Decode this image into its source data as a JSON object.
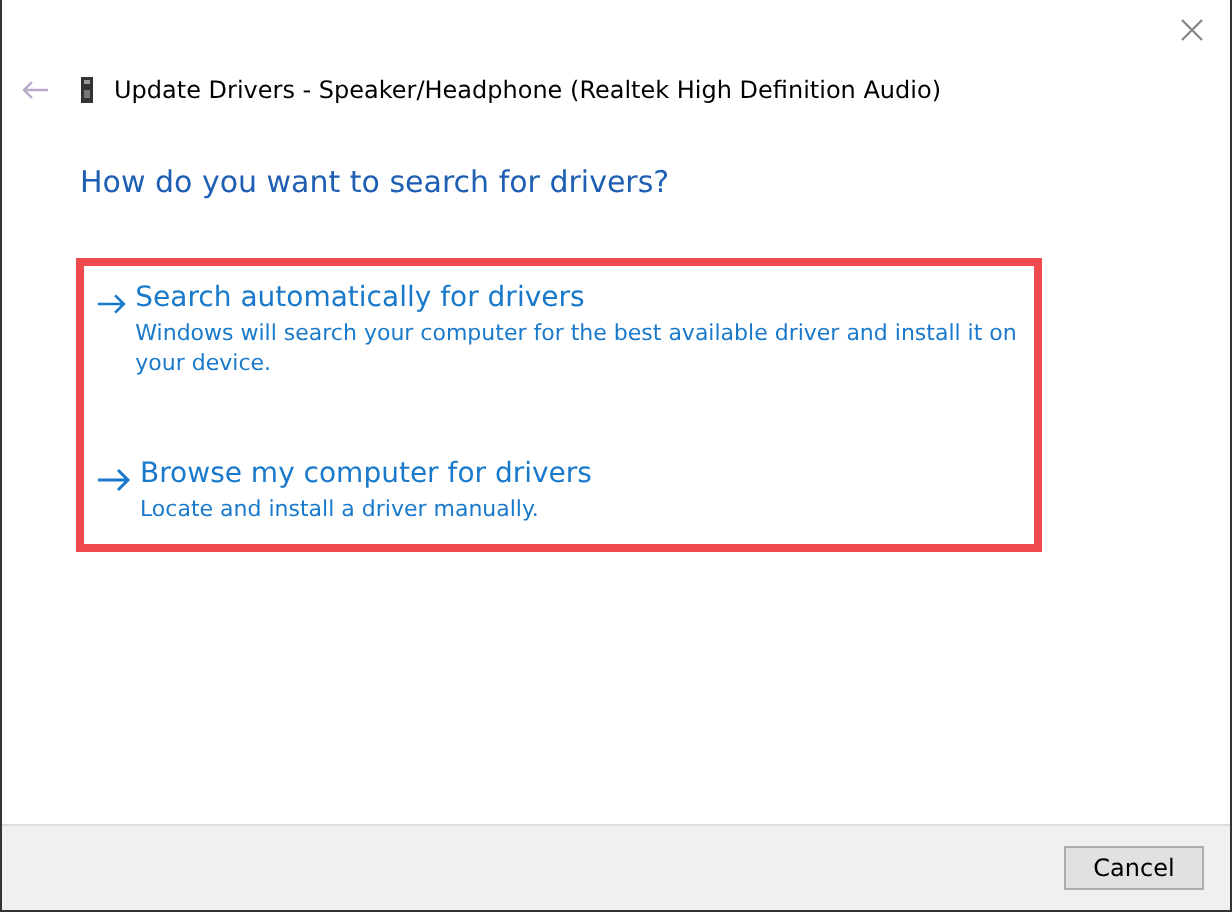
{
  "window": {
    "title": "Update Drivers - Speaker/Headphone (Realtek High Definition Audio)"
  },
  "heading": "How do you want to search for drivers?",
  "options": [
    {
      "title": "Search automatically for drivers",
      "description": "Windows will search your computer for the best available driver and install it on your device."
    },
    {
      "title": "Browse my computer for drivers",
      "description": "Locate and install a driver manually."
    }
  ],
  "buttons": [
    "Cancel"
  ]
}
